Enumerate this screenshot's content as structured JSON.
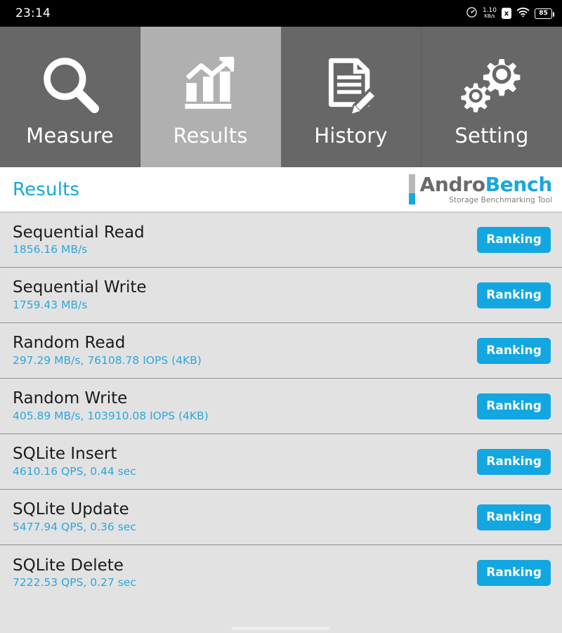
{
  "statusbar": {
    "clock": "23:14",
    "speed_value": "1.10",
    "speed_unit": "KB/s",
    "speed_icon": "speedometer-icon",
    "vpn_badge": "x",
    "wifi_icon": "wifi-icon",
    "battery_level": "85"
  },
  "tabs": [
    {
      "label": "Measure",
      "icon": "magnifier-icon",
      "active": false
    },
    {
      "label": "Results",
      "icon": "bar-chart-trend-icon",
      "active": true
    },
    {
      "label": "History",
      "icon": "document-pencil-icon",
      "active": false
    },
    {
      "label": "Setting",
      "icon": "gears-icon",
      "active": false
    }
  ],
  "header": {
    "title": "Results",
    "logo_andro": "Andro",
    "logo_bench": "Bench",
    "logo_tagline": "Storage Benchmarking Tool"
  },
  "results": [
    {
      "name": "Sequential Read",
      "value": "1856.16 MB/s",
      "button": "Ranking"
    },
    {
      "name": "Sequential Write",
      "value": "1759.43 MB/s",
      "button": "Ranking"
    },
    {
      "name": "Random Read",
      "value": "297.29 MB/s, 76108.78 IOPS (4KB)",
      "button": "Ranking"
    },
    {
      "name": "Random Write",
      "value": "405.89 MB/s, 103910.08 IOPS (4KB)",
      "button": "Ranking"
    },
    {
      "name": "SQLite Insert",
      "value": "4610.16 QPS, 0.44 sec",
      "button": "Ranking"
    },
    {
      "name": "SQLite Update",
      "value": "5477.94 QPS, 0.36 sec",
      "button": "Ranking"
    },
    {
      "name": "SQLite Delete",
      "value": "7222.53 QPS, 0.27 sec",
      "button": "Ranking"
    }
  ],
  "colors": {
    "accent": "#13a7e2",
    "value_text": "#2ca7dd",
    "tab_inactive": "#676767",
    "tab_active": "#b0b0b0",
    "row_bg": "#e2e2e2"
  }
}
